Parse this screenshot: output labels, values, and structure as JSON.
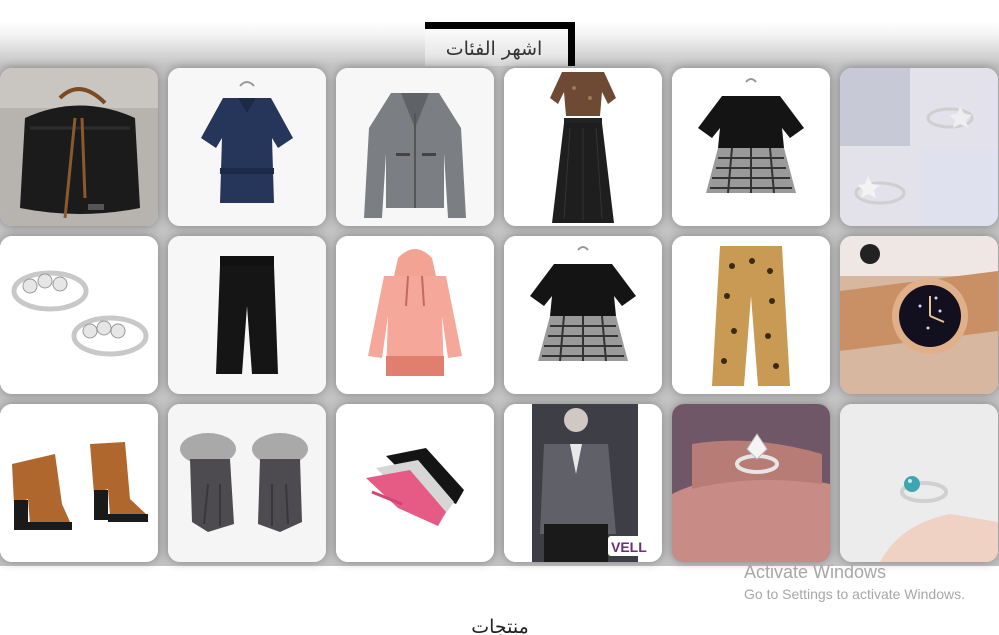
{
  "section": {
    "title": "اشهر الفئات"
  },
  "tiles": [
    {
      "icon": "bucket-bag-icon"
    },
    {
      "icon": "navy-blouse-icon"
    },
    {
      "icon": "grey-jacket-icon"
    },
    {
      "icon": "sequin-top-skirt-icon"
    },
    {
      "icon": "gingham-top-icon"
    },
    {
      "icon": "star-ring-icon"
    },
    {
      "icon": "crystal-rings-icon"
    },
    {
      "icon": "black-trousers-icon"
    },
    {
      "icon": "pink-hoodie-icon"
    },
    {
      "icon": "gingham-top-icon"
    },
    {
      "icon": "leopard-trousers-icon"
    },
    {
      "icon": "rose-gold-watch-icon"
    },
    {
      "icon": "ankle-boots-icon"
    },
    {
      "icon": "fur-gloves-icon"
    },
    {
      "icon": "socks-icon"
    },
    {
      "icon": "grey-blazer-icon",
      "brand": "VELL"
    },
    {
      "icon": "diamond-ring-icon"
    },
    {
      "icon": "blue-stone-ring-icon"
    }
  ],
  "watermark": {
    "title": "Activate Windows",
    "subtitle": "Go to Settings to activate Windows."
  },
  "next_section": {
    "title": "منتجات"
  },
  "colors": {
    "accent": "#000000",
    "band": "#c4c4c4",
    "tile_bg": "#f4f4f4"
  }
}
